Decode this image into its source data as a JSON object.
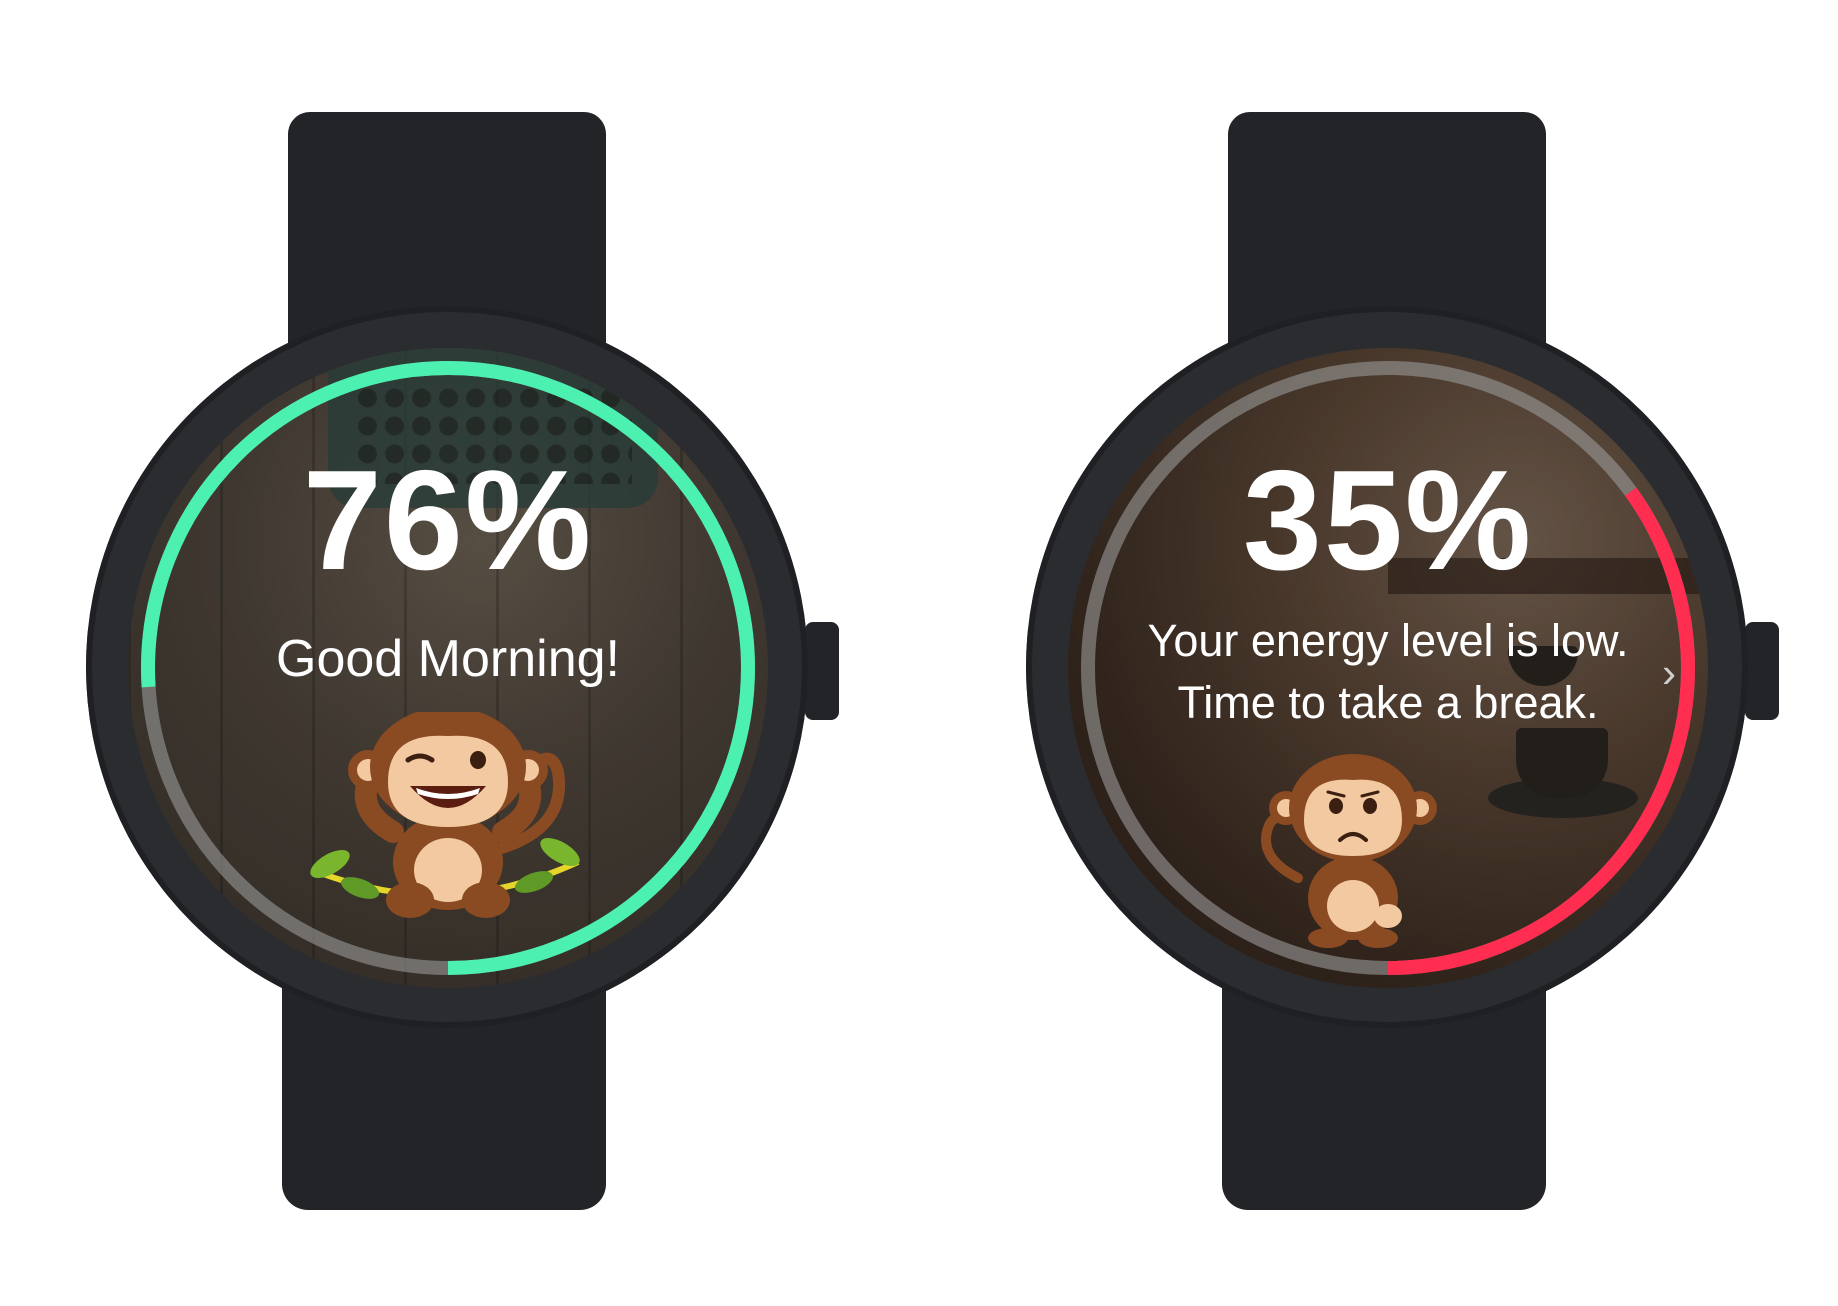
{
  "watches": [
    {
      "percent_label": "76%",
      "energy_percent": 76,
      "message_lines": [
        "Good Morning!"
      ],
      "ring_color": "#4cf0b0",
      "track_color": "#9a9a9a",
      "mascot": "monkey-happy-icon"
    },
    {
      "percent_label": "35%",
      "energy_percent": 35,
      "message_lines": [
        "Your energy level is low.",
        "Time to take a break."
      ],
      "ring_color": "#ff2d4f",
      "track_color": "#9a9a9a",
      "mascot": "monkey-sad-icon",
      "next_indicator": "chevron-right-icon"
    }
  ],
  "colors": {
    "band": "#232427",
    "case": "#2a2c30",
    "text": "#ffffff"
  }
}
